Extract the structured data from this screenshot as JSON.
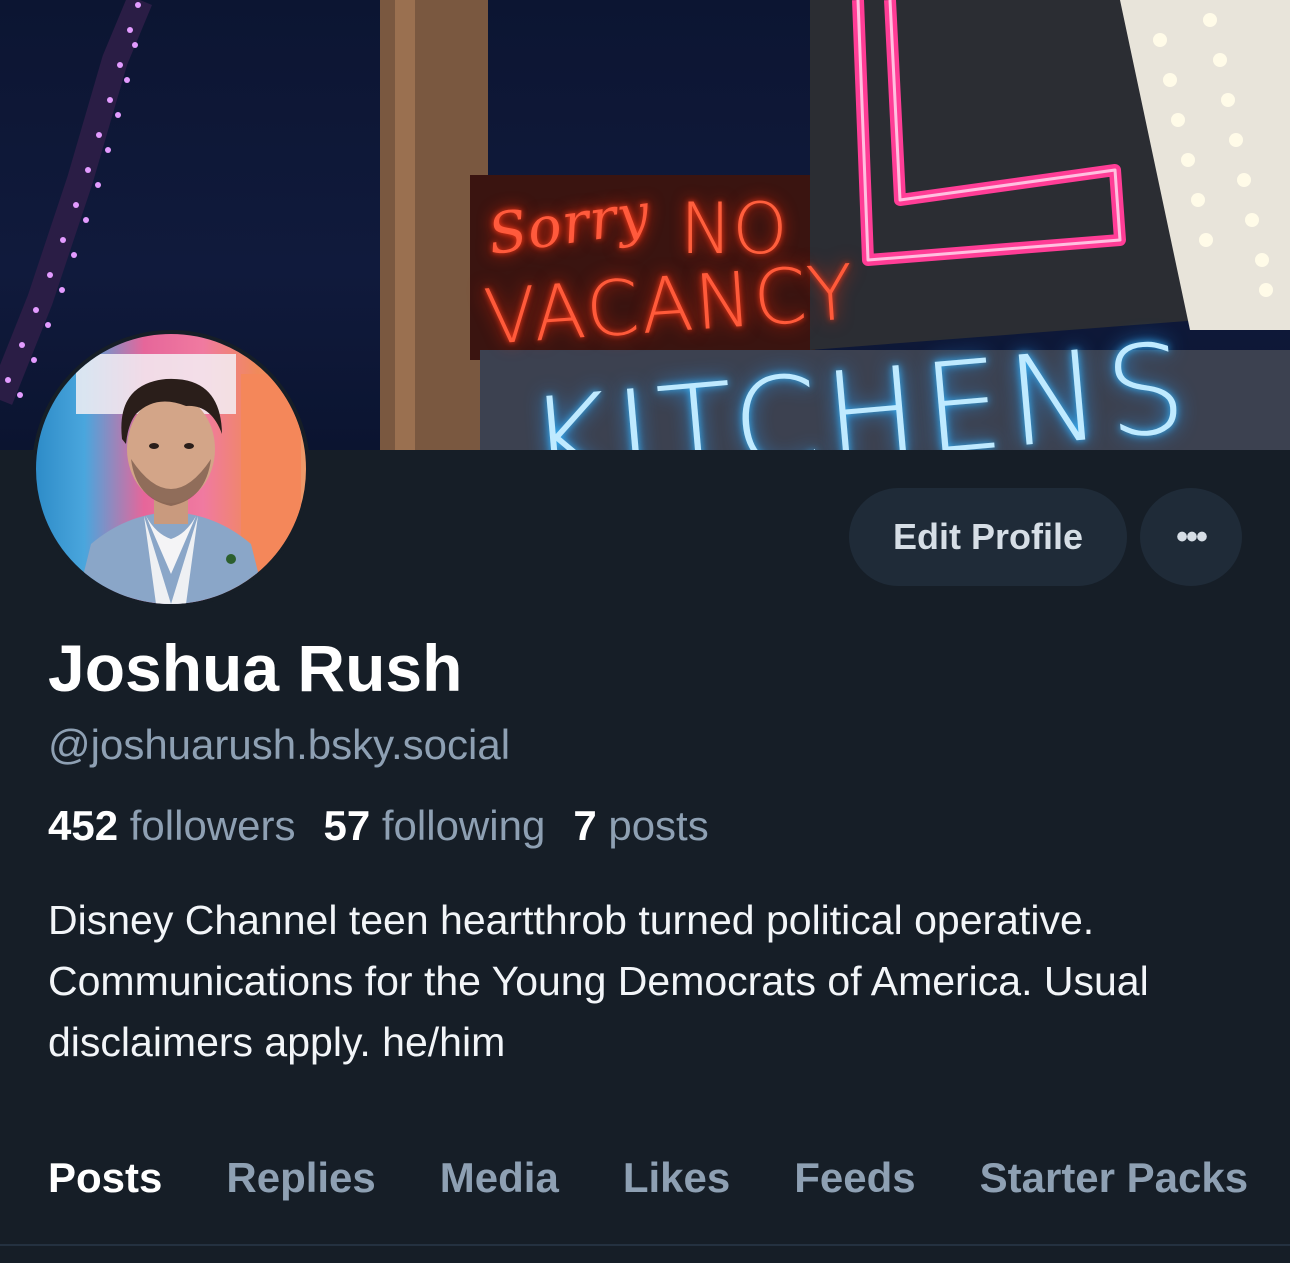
{
  "banner": {
    "sign_sorry": "Sorry",
    "sign_no": "NO",
    "sign_vacancy": "VACANCY",
    "sign_kitchens": "KITCHENS"
  },
  "profile": {
    "display_name": "Joshua Rush",
    "handle": "@joshuarush.bsky.social",
    "bio": "Disney Channel teen heartthrob turned political operative. Communications for the Young Democrats of America. Usual disclaimers apply. he/him"
  },
  "actions": {
    "edit_profile": "Edit Profile",
    "more": "•••"
  },
  "stats": {
    "followers_count": "452",
    "followers_label": "followers",
    "following_count": "57",
    "following_label": "following",
    "posts_count": "7",
    "posts_label": "posts"
  },
  "tabs": [
    {
      "label": "Posts",
      "active": true
    },
    {
      "label": "Replies",
      "active": false
    },
    {
      "label": "Media",
      "active": false
    },
    {
      "label": "Likes",
      "active": false
    },
    {
      "label": "Feeds",
      "active": false
    },
    {
      "label": "Starter Packs",
      "active": false
    }
  ],
  "colors": {
    "background": "#161e27",
    "accent": "#1d8bf0",
    "button_bg": "#1f2b38",
    "muted_text": "#8ea0b3"
  }
}
